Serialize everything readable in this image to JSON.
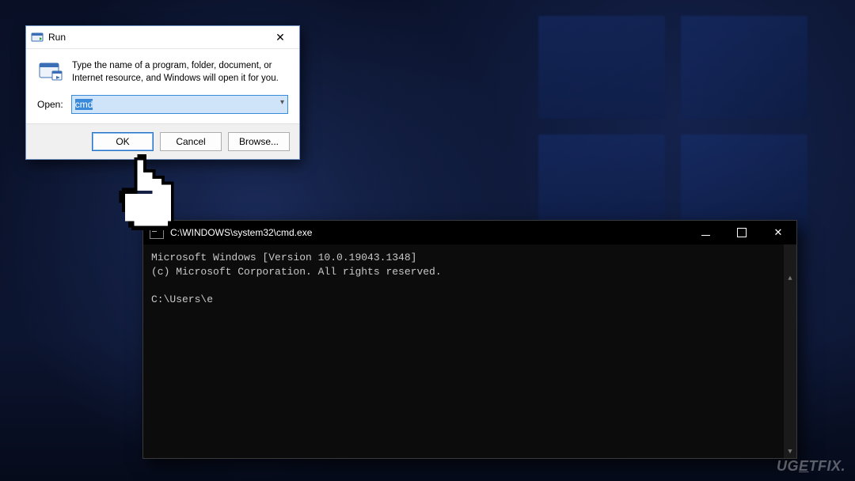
{
  "watermark": "UGETFIX.",
  "run": {
    "title": "Run",
    "description": "Type the name of a program, folder, document, or Internet resource, and Windows will open it for you.",
    "open_label": "Open:",
    "open_value": "cmd",
    "buttons": {
      "ok": "OK",
      "cancel": "Cancel",
      "browse": "Browse..."
    }
  },
  "cmd": {
    "title": "C:\\WINDOWS\\system32\\cmd.exe",
    "lines": [
      "Microsoft Windows [Version 10.0.19043.1348]",
      "(c) Microsoft Corporation. All rights reserved.",
      "",
      "C:\\Users\\e"
    ]
  }
}
